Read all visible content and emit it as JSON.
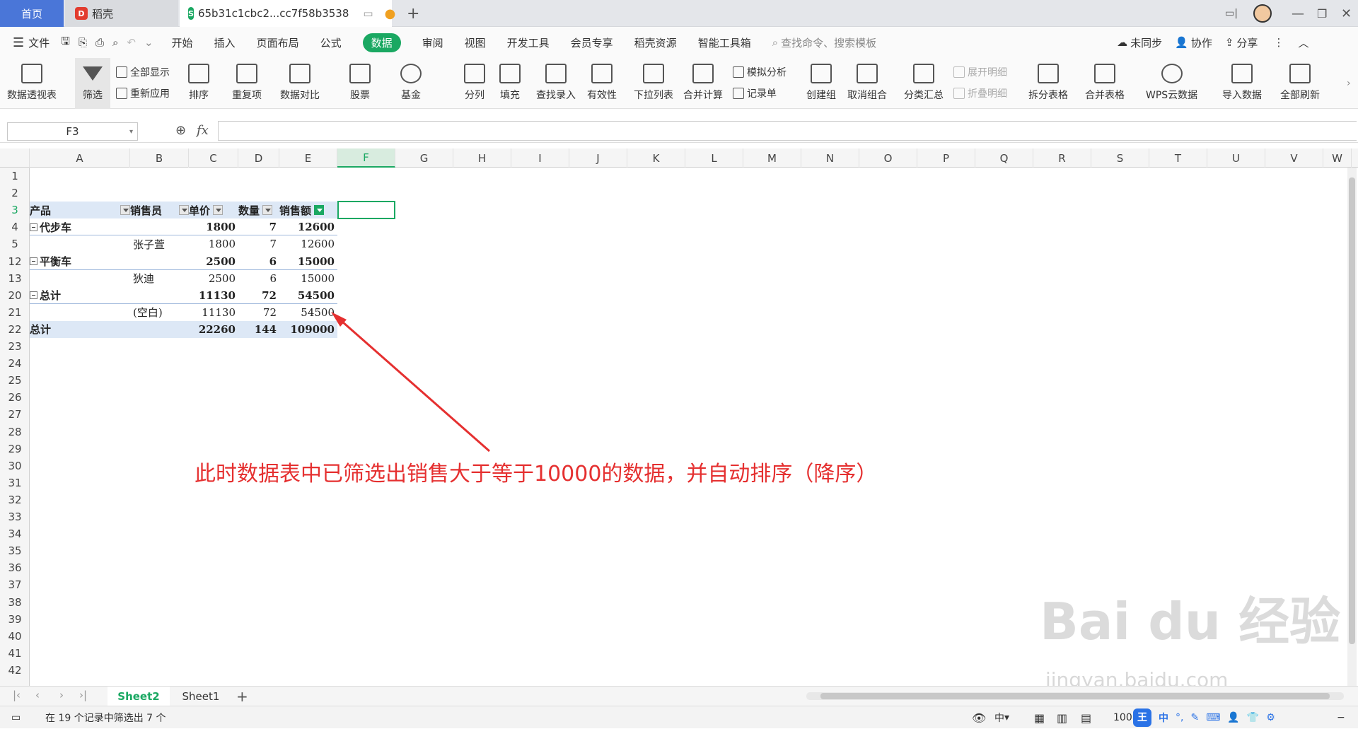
{
  "tabs": {
    "home": "首页",
    "daoke": "稻壳",
    "file": "65b31c1cbc2...cc7f58b3538",
    "new_tab": "+"
  },
  "menu": {
    "items": [
      "文件",
      "开始",
      "插入",
      "页面布局",
      "公式",
      "数据",
      "审阅",
      "视图",
      "开发工具",
      "会员专享",
      "稻壳资源",
      "智能工具箱"
    ],
    "active": "数据",
    "search": "查找命令、搜索模板",
    "sync": "未同步",
    "collab": "协作",
    "share": "分享"
  },
  "ribbon": {
    "pivot": "数据透视表",
    "filter": "筛选",
    "show_all": "全部显示",
    "reapply": "重新应用",
    "sort": "排序",
    "duplicates": "重复项",
    "compare": "数据对比",
    "stock": "股票",
    "fund": "基金",
    "split": "分列",
    "fill": "填充",
    "lookup": "查找录入",
    "validity": "有效性",
    "dropdown": "下拉列表",
    "consolidate": "合并计算",
    "simulate": "模拟分析",
    "record": "记录单",
    "group": "创建组",
    "ungroup": "取消组合",
    "subtotal": "分类汇总",
    "expand": "展开明细",
    "collapse": "折叠明细",
    "split_table": "拆分表格",
    "merge_table": "合并表格",
    "wps_cloud": "WPS云数据",
    "import": "导入数据",
    "refresh_all": "全部刷新"
  },
  "formula": {
    "namebox": "F3",
    "fx": "fx",
    "value": ""
  },
  "columns": [
    "A",
    "B",
    "C",
    "D",
    "E",
    "F",
    "G",
    "H",
    "I",
    "J",
    "K",
    "L",
    "M",
    "N",
    "O",
    "P",
    "Q",
    "R",
    "S",
    "T",
    "U",
    "V",
    "W"
  ],
  "rows": [
    "1",
    "2",
    "3",
    "4",
    "5",
    "12",
    "13",
    "20",
    "21",
    "22",
    "23",
    "24",
    "25",
    "26",
    "27",
    "28",
    "29",
    "30",
    "31",
    "32",
    "33",
    "34",
    "35",
    "36",
    "37",
    "38",
    "39",
    "40",
    "41",
    "42"
  ],
  "pivot": {
    "headers": {
      "product": "产品",
      "salesperson": "销售员",
      "price": "单价",
      "qty": "数量",
      "amount": "销售额"
    },
    "r4": {
      "a": "代步车",
      "c": "1800",
      "d": "7",
      "e": "12600"
    },
    "r5": {
      "b": "张子萱",
      "c": "1800",
      "d": "7",
      "e": "12600"
    },
    "r12": {
      "a": "平衡车",
      "c": "2500",
      "d": "6",
      "e": "15000"
    },
    "r13": {
      "b": "狄迪",
      "c": "2500",
      "d": "6",
      "e": "15000"
    },
    "r20": {
      "a": "总计",
      "c": "11130",
      "d": "72",
      "e": "54500"
    },
    "r21": {
      "b": "(空白)",
      "c": "11130",
      "d": "72",
      "e": "54500"
    },
    "r22": {
      "a": "总计",
      "c": "22260",
      "d": "144",
      "e": "109000"
    }
  },
  "annotation": "此时数据表中已筛选出销售大于等于10000的数据，并自动排序（降序）",
  "sheets": {
    "active": "Sheet2",
    "other": "Sheet1",
    "add": "+"
  },
  "status": {
    "text": "在 19 个记录中筛选出 7 个",
    "zoom": "100",
    "ime": "中"
  },
  "watermark": {
    "main": "Bai du 经验",
    "sub": "jingyan.baidu.com"
  },
  "colors": {
    "accent": "#1aa862",
    "tab_home": "#4a76d8",
    "annotation": "#e53030"
  }
}
